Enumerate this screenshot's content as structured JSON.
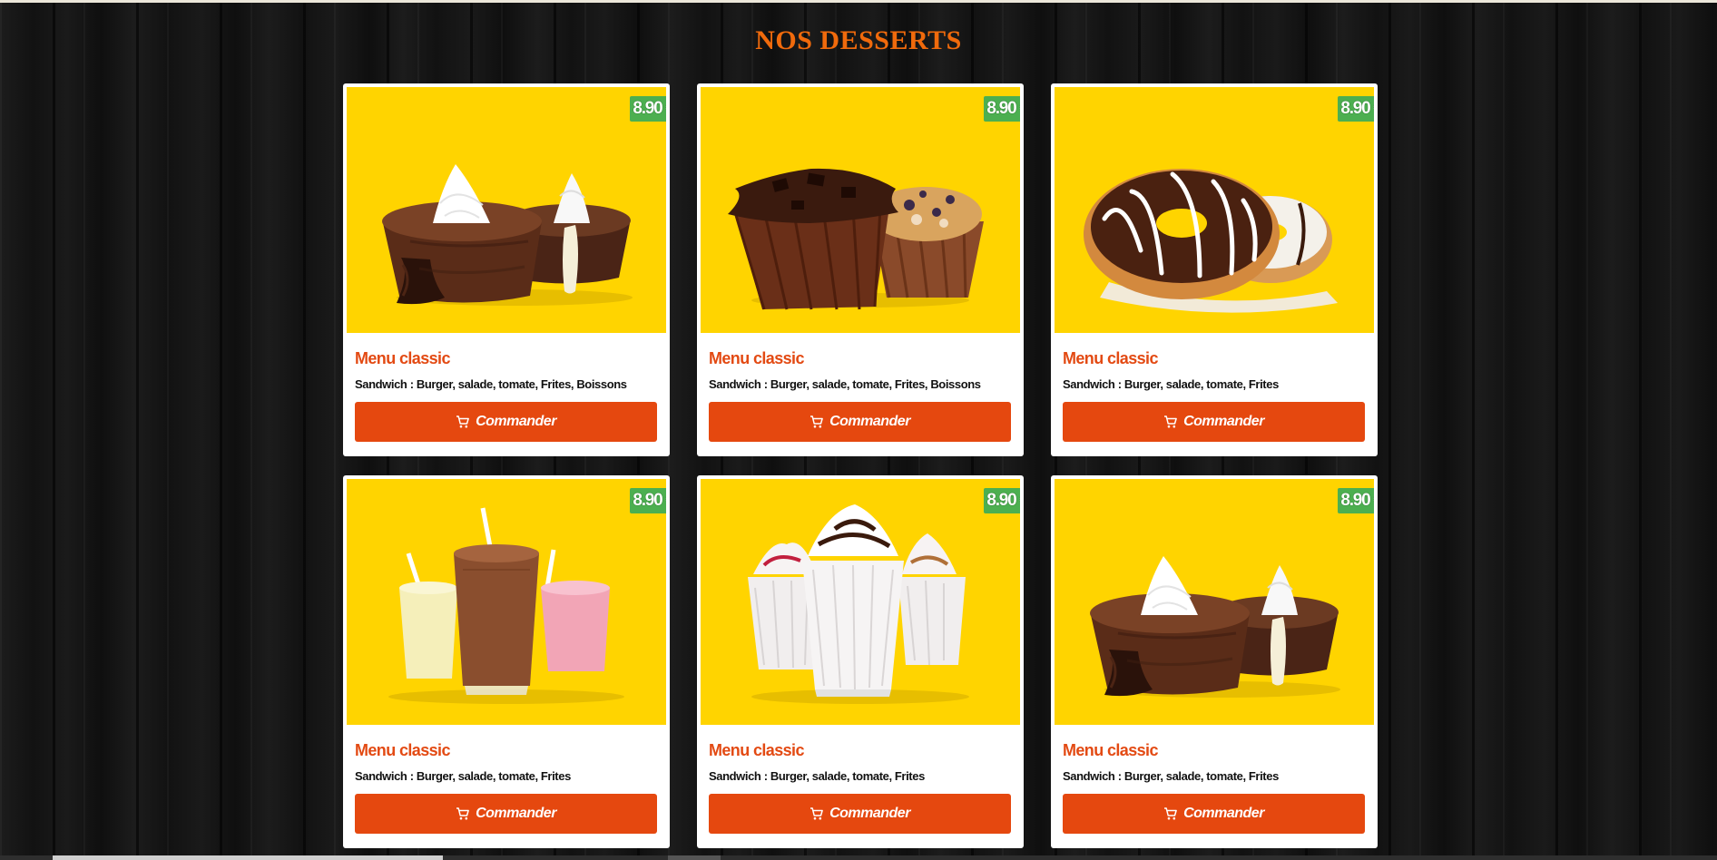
{
  "page": {
    "title": "NOS DESSERTS"
  },
  "colors": {
    "title": "#f06a0c",
    "card_image_bg": "#ffd400",
    "price_badge": "#4caf50",
    "button": "#e5480f",
    "card_title": "#e34a13"
  },
  "products": [
    {
      "image": "lava-cake-icon",
      "price": "8.90 €",
      "title": "Menu classic",
      "description": "Sandwich : Burger, salade, tomate, Frites, Boissons",
      "button_label": "Commander"
    },
    {
      "image": "muffin-icon",
      "price": "8.90 €",
      "title": "Menu classic",
      "description": "Sandwich : Burger, salade, tomate, Frites, Boissons",
      "button_label": "Commander"
    },
    {
      "image": "donut-icon",
      "price": "8.90 €",
      "title": "Menu classic",
      "description": "Sandwich : Burger, salade, tomate, Frites",
      "button_label": "Commander"
    },
    {
      "image": "milkshake-icon",
      "price": "8.90 €",
      "title": "Menu classic",
      "description": "Sandwich : Burger, salade, tomate, Frites",
      "button_label": "Commander"
    },
    {
      "image": "sundae-icon",
      "price": "8.90 €",
      "title": "Menu classic",
      "description": "Sandwich : Burger, salade, tomate, Frites",
      "button_label": "Commander"
    },
    {
      "image": "lava-cake-icon",
      "price": "8.90 €",
      "title": "Menu classic",
      "description": "Sandwich : Burger, salade, tomate, Frites",
      "button_label": "Commander"
    }
  ],
  "button_icon": "cart-icon"
}
